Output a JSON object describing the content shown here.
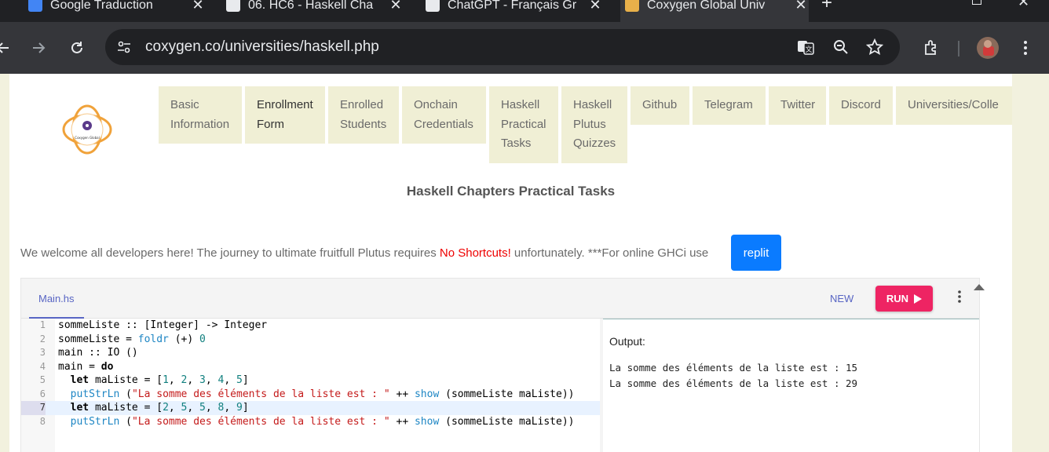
{
  "browser": {
    "tabs": [
      {
        "title": "Google Traduction",
        "favicon": "google-translate-icon",
        "favicon_color": "#4285f4"
      },
      {
        "title": "06. HC6 - Haskell Cha",
        "favicon": "github-icon",
        "favicon_color": "#e8eaed"
      },
      {
        "title": "ChatGPT - Français Gr",
        "favicon": "chatgpt-icon",
        "favicon_color": "#e8eaed"
      },
      {
        "title": "Coxygen Global Univ",
        "favicon": "coxygen-icon",
        "favicon_color": "#e8b04a",
        "active": true
      }
    ],
    "new_tab": "+",
    "url": "coxygen.co/universities/haskell.php"
  },
  "site": {
    "nav": [
      {
        "label": "Basic\nInformation"
      },
      {
        "label": "Enrollment\nForm",
        "current": true
      },
      {
        "label": "Enrolled\nStudents"
      },
      {
        "label": "Onchain\nCredentials"
      },
      {
        "label": "Haskell\nPractical\nTasks"
      },
      {
        "label": "Haskell\nPlutus\nQuizzes"
      },
      {
        "label": "Github"
      },
      {
        "label": "Telegram"
      },
      {
        "label": "Twitter"
      },
      {
        "label": "Discord"
      },
      {
        "label": "Universities/Colle"
      }
    ],
    "heading": "Haskell Chapters Practical Tasks",
    "welcome_pre": "We welcome all developers here! The journey to ultimate fruitfull Plutus requires ",
    "welcome_red": "No Shortcuts!",
    "welcome_post": " unfortunately. ***For online GHCi use",
    "replit_label": "replit"
  },
  "editor": {
    "file_tab": "Main.hs",
    "new_label": "NEW",
    "run_label": "RUN",
    "active_line": 7,
    "code": [
      "sommeListe :: [Integer] -> Integer",
      "sommeListe = foldr (+) 0",
      "main :: IO ()",
      "main = do",
      "  let maListe = [1, 2, 3, 4, 5]",
      "  putStrLn (\"La somme des éléments de la liste est : \" ++ show (sommeListe maListe))",
      "  let maListe = [2, 5, 5, 8, 9]",
      "  putStrLn (\"La somme des éléments de la liste est : \" ++ show (sommeListe maListe))"
    ],
    "output_label": "Output:",
    "output": [
      "La somme des éléments de la liste est : 15",
      "La somme des éléments de la liste est : 29"
    ]
  }
}
